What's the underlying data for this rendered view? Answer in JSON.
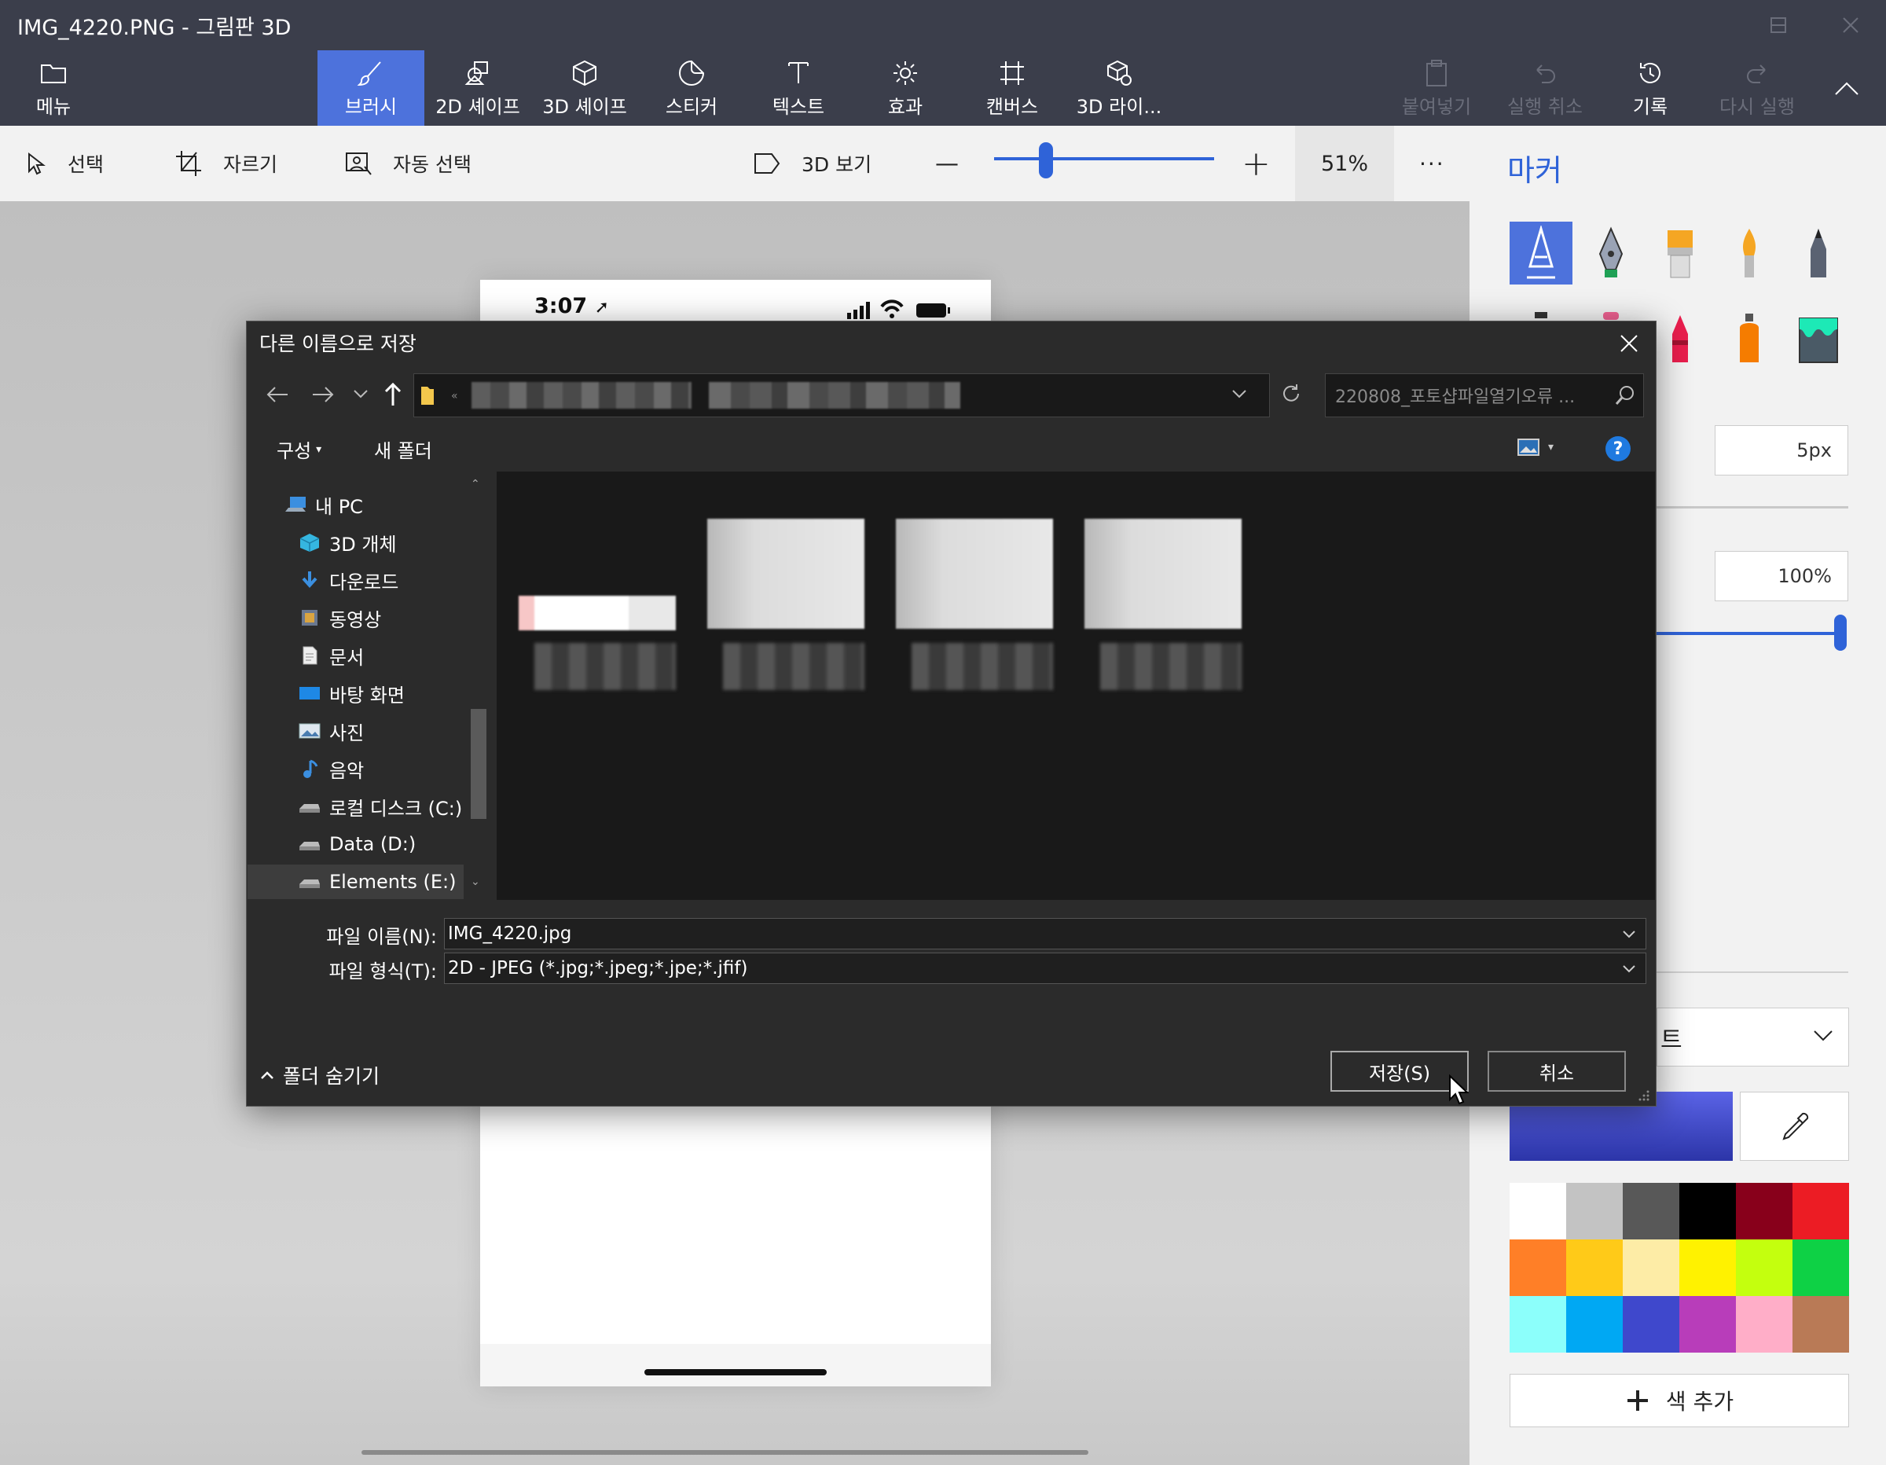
{
  "window": {
    "title": "IMG_4220.PNG - 그림판 3D"
  },
  "ribbon": {
    "menu": "메뉴",
    "tabs": [
      {
        "label": "브러시",
        "active": true
      },
      {
        "label": "2D 셰이프"
      },
      {
        "label": "3D 셰이프"
      },
      {
        "label": "스티커"
      },
      {
        "label": "텍스트"
      },
      {
        "label": "효과"
      },
      {
        "label": "캔버스"
      },
      {
        "label": "3D 라이..."
      }
    ],
    "paste": "붙여넣기",
    "undo": "실행 취소",
    "history": "기록",
    "redo": "다시 실행"
  },
  "toolbar": {
    "select": "선택",
    "crop": "자르기",
    "magic_select": "자동 선택",
    "view_3d": "3D 보기",
    "zoom_minus": "—",
    "zoom_plus": "+",
    "zoom_level": 0.51,
    "zoom_label": "51%",
    "more": "···"
  },
  "canvas": {
    "phone_time": "3:07"
  },
  "panel": {
    "title": "마커",
    "thickness": "5px",
    "opacity": "100%",
    "finish_partial": "트",
    "add_color": "색 추가",
    "current_color": "#3b46c9",
    "palette": [
      "#ffffff",
      "#c3c3c3",
      "#585858",
      "#000000",
      "#88001b",
      "#ec1c24",
      "#ff7f27",
      "#ffca18",
      "#fdeca6",
      "#fff200",
      "#c4ff0e",
      "#0ed145",
      "#8cfffb",
      "#00a8f3",
      "#3f48cc",
      "#b83dba",
      "#ffaec8",
      "#b97a56"
    ]
  },
  "dialog": {
    "title": "다른 이름으로 저장",
    "search_placeholder": "220808_포토샵파일열기오류 ...",
    "organize": "구성",
    "new_folder": "새 폴더",
    "help": "?",
    "nav": [
      {
        "label": "내 PC",
        "icon": "pc-icon"
      },
      {
        "label": "3D 개체",
        "icon": "cube-icon"
      },
      {
        "label": "다운로드",
        "icon": "download-icon"
      },
      {
        "label": "동영상",
        "icon": "video-icon"
      },
      {
        "label": "문서",
        "icon": "document-icon"
      },
      {
        "label": "바탕 화면",
        "icon": "desktop-icon"
      },
      {
        "label": "사진",
        "icon": "picture-icon"
      },
      {
        "label": "음악",
        "icon": "music-icon"
      },
      {
        "label": "로컬 디스크 (C:)",
        "icon": "drive-icon"
      },
      {
        "label": "Data (D:)",
        "icon": "drive-icon"
      },
      {
        "label": "Elements (E:)",
        "icon": "drive-icon"
      }
    ],
    "filename_label": "파일 이름(N):",
    "filename_value": "IMG_4220.jpg",
    "filetype_label": "파일 형식(T):",
    "filetype_value": "2D - JPEG (*.jpg;*.jpeg;*.jpe;*.jfif)",
    "hide_folders": "폴더 숨기기",
    "save": "저장(S)",
    "cancel": "취소"
  }
}
